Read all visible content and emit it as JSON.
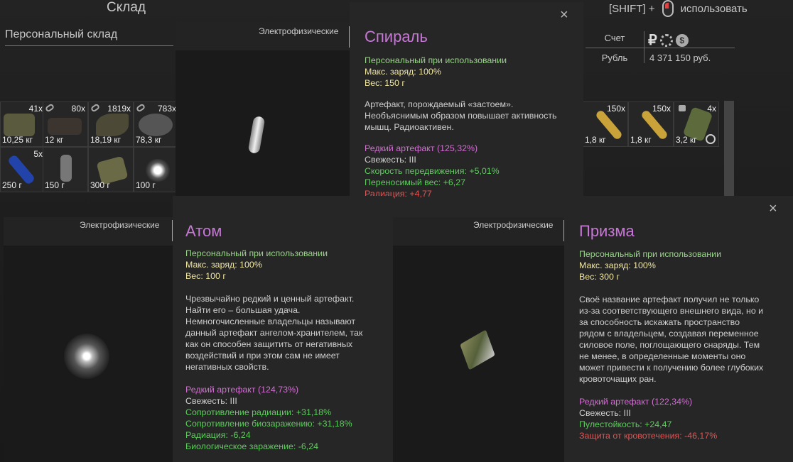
{
  "header": {
    "title": "Склад",
    "personal_tab": "Персональный склад",
    "shift_key": "[SHIFT] +",
    "use_label": "использовать"
  },
  "account": {
    "col_header": "Счет",
    "currency_label": "Рубль",
    "ruble_symbol": "₽",
    "coin_symbol": "$",
    "money": "4 371 150 руб."
  },
  "inventory": {
    "left_row1": [
      {
        "count": "41x",
        "weight": "10,25 кг"
      },
      {
        "count": "80x",
        "weight": "12 кг"
      },
      {
        "count": "1819x",
        "weight": "18,19 кг"
      },
      {
        "count": "783x",
        "weight": "78,3 кг"
      }
    ],
    "left_row2": [
      {
        "count": "5x",
        "weight": "250 г"
      },
      {
        "count": "",
        "weight": "150 г"
      },
      {
        "count": "",
        "weight": "300 г"
      },
      {
        "count": "",
        "weight": "100 г"
      }
    ],
    "right_row1": [
      {
        "count": "150x",
        "weight": "1,8 кг"
      },
      {
        "count": "150x",
        "weight": "1,8 кг"
      },
      {
        "count": "4x",
        "weight": "3,2 кг"
      }
    ]
  },
  "tooltips": [
    {
      "category": "Электрофизические",
      "name": "Спираль",
      "binding": "Персональный при использовании",
      "charge": "Макс. заряд: 100%",
      "weight": "Вес: 150 г",
      "desc": [
        "Артефакт, порождаемый «застоем».",
        "Необъяснимым образом повышает активность",
        "мышц. Радиоактивен."
      ],
      "rarity": "Редкий артефакт (125,32%)",
      "freshness": "Свежесть: III",
      "stats": [
        {
          "text": "Скорость передвижения: +5,01%",
          "kind": "good"
        },
        {
          "text": "Переносимый вес: +6,27",
          "kind": "good"
        },
        {
          "text": "Радиация: +4,77",
          "kind": "bad"
        }
      ]
    },
    {
      "category": "Электрофизические",
      "name": "Атом",
      "binding": "Персональный при использовании",
      "charge": "Макс. заряд: 100%",
      "weight": "Вес: 100 г",
      "desc": [
        "Чрезвычайно редкий и ценный артефакт.",
        "Найти его – большая удача.",
        "Немногочисленные владельцы называют",
        "данный артефакт ангелом-хранителем, так",
        "как он способен защитить от негативных",
        "воздействий и при этом сам не имеет",
        "негативных свойств."
      ],
      "rarity": "Редкий артефакт (124,73%)",
      "freshness": "Свежесть: III",
      "stats": [
        {
          "text": "Сопротивление радиации: +31,18%",
          "kind": "good"
        },
        {
          "text": "Сопротивление биозаражению: +31,18%",
          "kind": "good"
        },
        {
          "text": "Радиация: -6,24",
          "kind": "good"
        },
        {
          "text": "Биологическое заражение: -6,24",
          "kind": "good"
        }
      ]
    },
    {
      "category": "Электрофизические",
      "name": "Призма",
      "binding": "Персональный при использовании",
      "charge": "Макс. заряд: 100%",
      "weight": "Вес: 300 г",
      "desc": [
        "Своё название артефакт получил не только",
        "из-за соответствующего внешнего вида, но и",
        "за способность искажать пространство",
        "рядом с владельцем, создавая переменное",
        "силовое поле, поглощающего снаряды. Тем",
        "не менее, в определенные моменты оно",
        "может привести к получению более глубоких",
        "кровоточащих ран."
      ],
      "rarity": "Редкий артефакт (122,34%)",
      "freshness": "Свежесть: III",
      "stats": [
        {
          "text": "Пулестойкость: +24,47",
          "kind": "good"
        },
        {
          "text": "Защита от кровотечения: -46,17%",
          "kind": "bad"
        }
      ]
    }
  ],
  "colors": {
    "artifact_name": "#c777d6",
    "good": "#5ecc5e",
    "bad": "#e05555",
    "rarity": "#cf70cf",
    "binding": "#9ad48a",
    "charge": "#f0e6a0"
  },
  "icons": {
    "close": "×"
  }
}
